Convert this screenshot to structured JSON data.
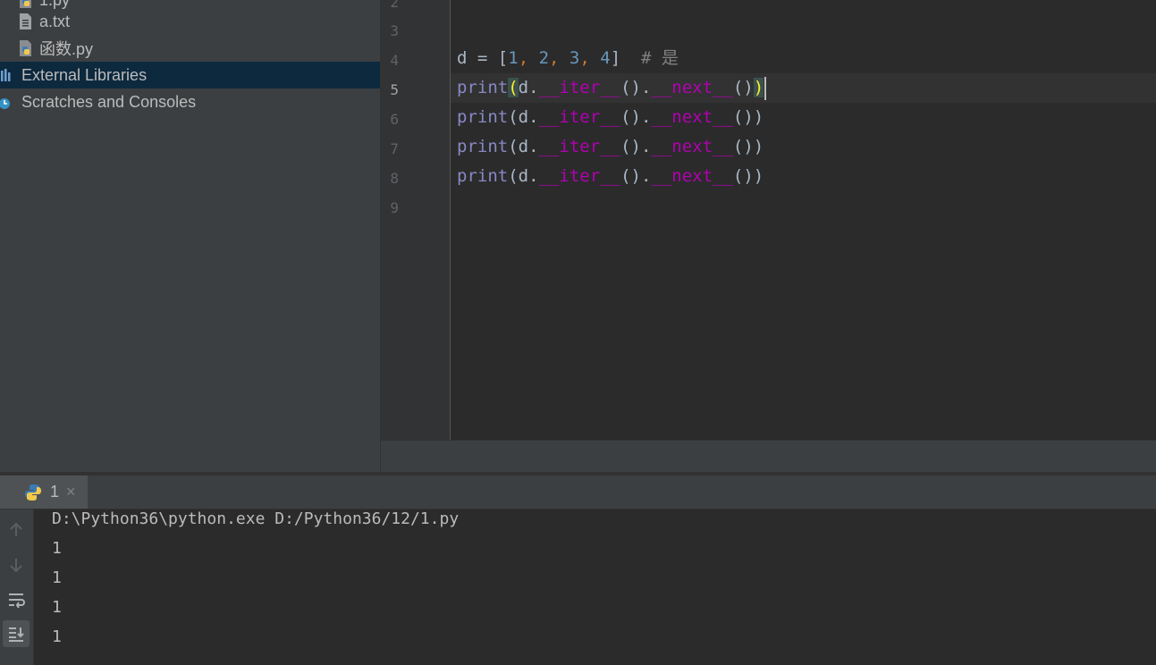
{
  "project_tree": {
    "items": [
      {
        "label": "1.py",
        "icon": "python-file-icon",
        "selected": false
      },
      {
        "label": "a.txt",
        "icon": "text-file-icon",
        "selected": false
      },
      {
        "label": "函数.py",
        "icon": "python-file-icon",
        "selected": false
      },
      {
        "label": "External Libraries",
        "icon": "library-icon",
        "selected": true
      },
      {
        "label": "Scratches and Consoles",
        "icon": "scratches-icon",
        "selected": false
      }
    ]
  },
  "editor": {
    "line_numbers": [
      "2",
      "3",
      "4",
      "5",
      "6",
      "7",
      "8",
      "9"
    ],
    "current_line": "5",
    "lines": {
      "l4": {
        "var": "d",
        "eq": " = ",
        "open": "[",
        "n1": "1",
        "c1": ", ",
        "n2": "2",
        "c2": ", ",
        "n3": "3",
        "c3": ", ",
        "n4": "4",
        "close": "]",
        "comment": "  # 是"
      },
      "call": {
        "func": "print",
        "open": "(",
        "obj": "d.",
        "iter": "__iter__",
        "mid": "().",
        "next": "__next__",
        "tail": "()",
        "close": ")"
      }
    }
  },
  "run_panel": {
    "tab_label": "1",
    "close_glyph": "×",
    "console": {
      "command": "D:\\Python36\\python.exe D:/Python36/12/1.py",
      "outputs": [
        "1",
        "1",
        "1",
        "1"
      ]
    },
    "tools": [
      "up-arrow-icon",
      "down-arrow-icon",
      "soft-wrap-icon",
      "scroll-to-end-icon"
    ]
  },
  "colors": {
    "editor_bg": "#2b2b2b",
    "sidebar_bg": "#3c3f41",
    "selection": "#0d293e",
    "keyword_func": "#8888c6",
    "number": "#6897bb",
    "dunder": "#b200b2",
    "comment": "#808080"
  }
}
